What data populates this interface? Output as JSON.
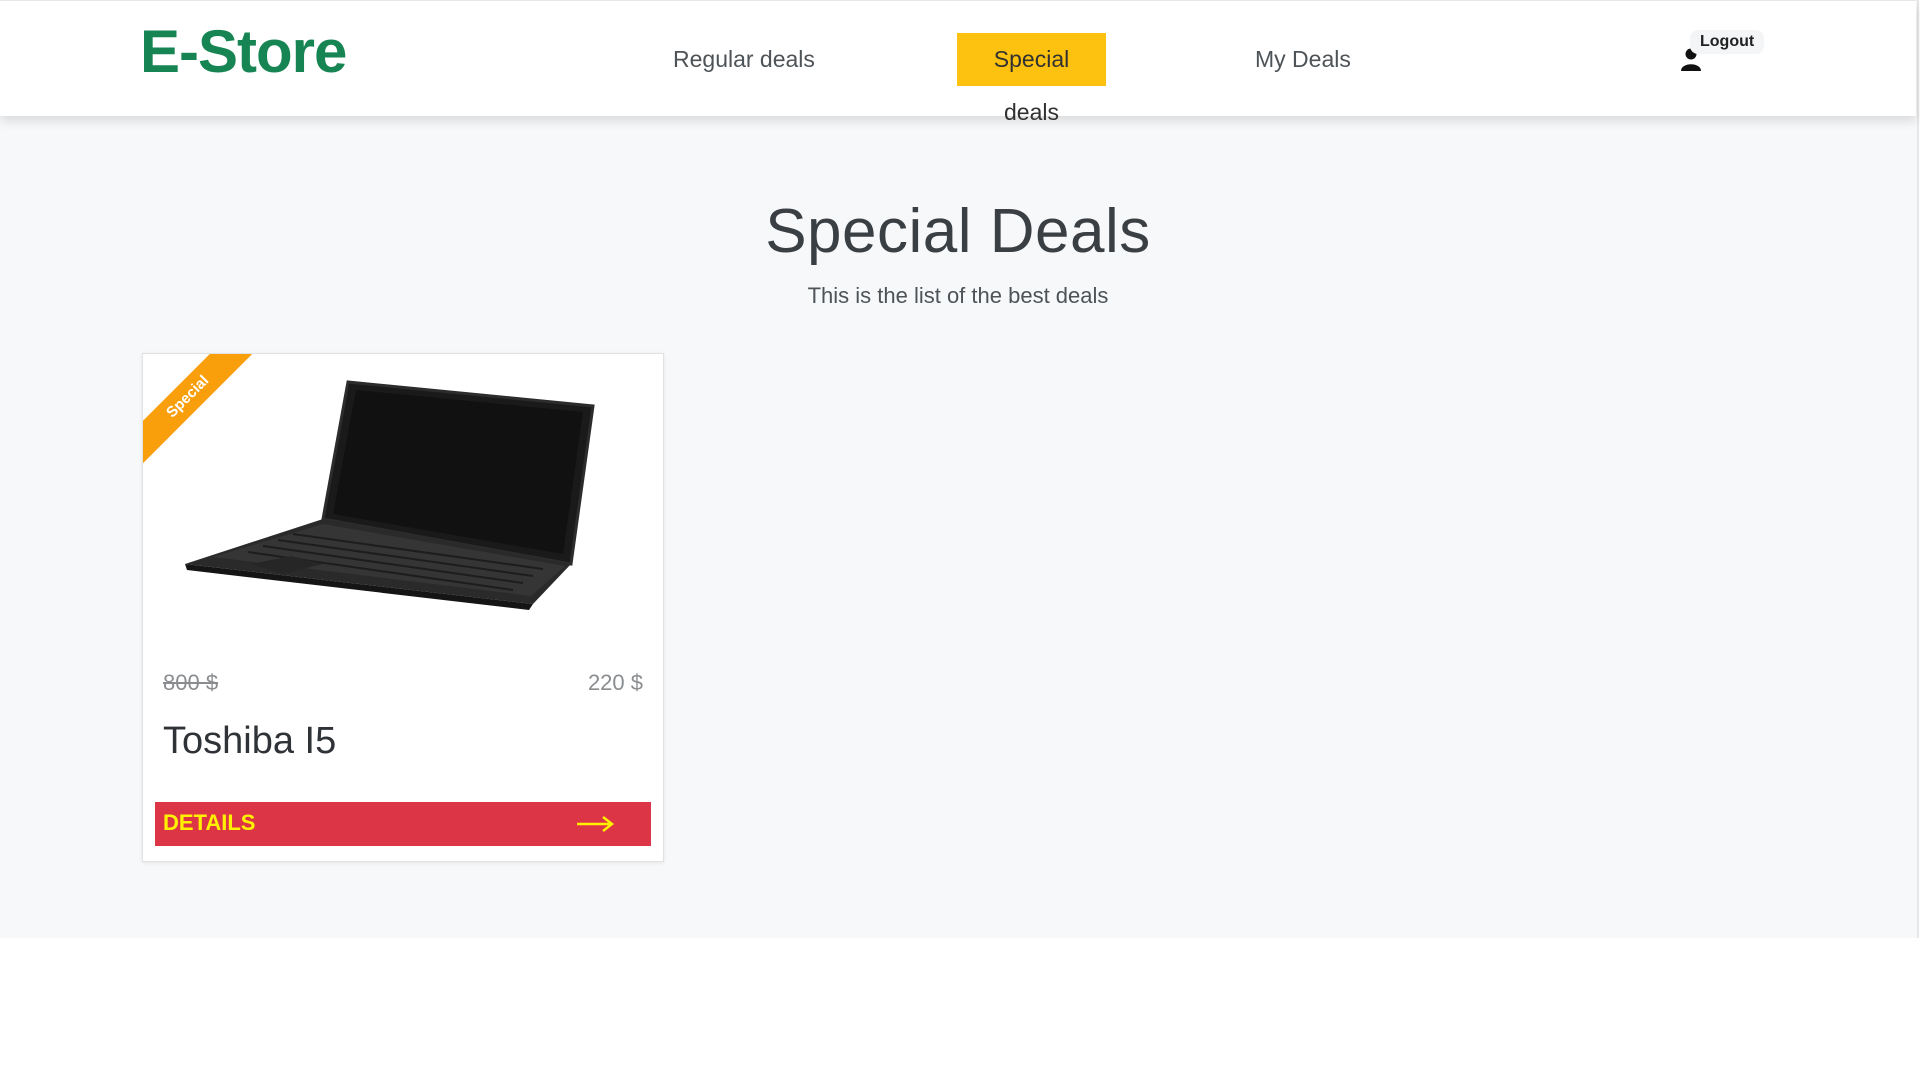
{
  "header": {
    "brand": "E-Store",
    "nav": {
      "regular": "Regular deals",
      "special": "Special deals",
      "mydeals": "My Deals"
    },
    "logout_label": "Logout"
  },
  "page": {
    "title": "Special Deals",
    "subtitle": "This is the list of the best deals"
  },
  "products": [
    {
      "badge": "Special",
      "old_price": "800 $",
      "new_price": "220 $",
      "name": "Toshiba I5",
      "details_label": "DETAILS"
    }
  ],
  "colors": {
    "brand": "#168553",
    "active_nav": "#fdc20f",
    "ribbon": "#f89f0b",
    "details_button": "#dc3545",
    "details_text": "#fff200"
  },
  "icons": {
    "user": "user-icon",
    "arrow": "arrow-right-icon"
  }
}
